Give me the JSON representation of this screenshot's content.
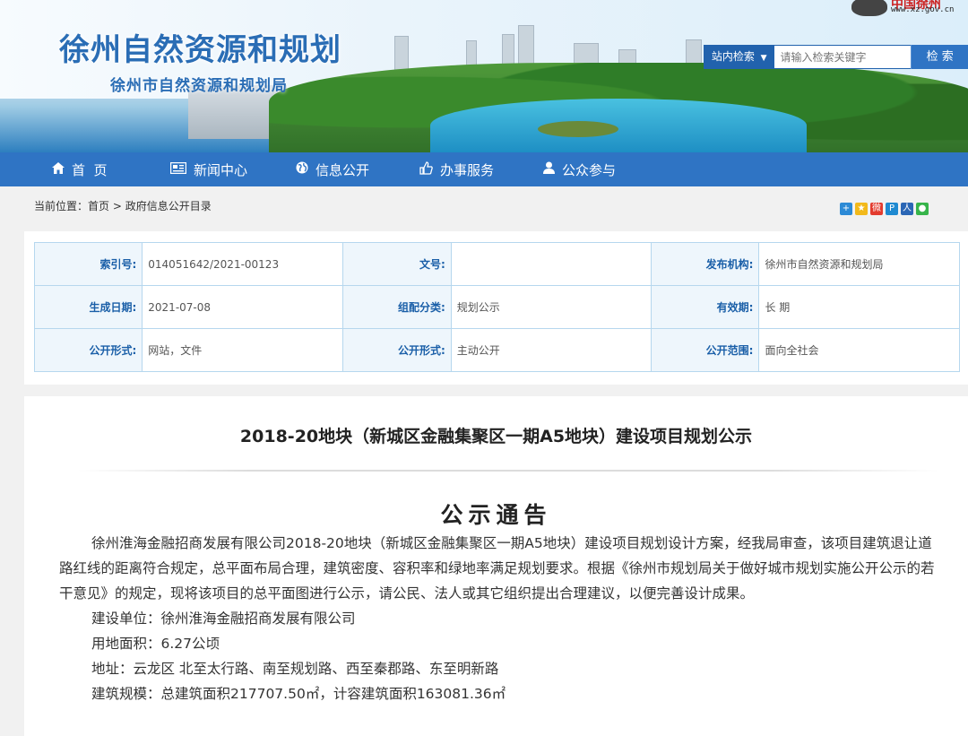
{
  "header": {
    "title": "徐州自然资源和规划",
    "subtitle": "徐州市自然资源和规划局",
    "logo_text": "中国徐州",
    "logo_url": "www.xz.gov.cn"
  },
  "search": {
    "scope_label": "站内检索",
    "placeholder": "请输入检索关键字",
    "button_label": "检 索"
  },
  "nav": {
    "items": [
      {
        "icon": "home-icon",
        "label": "首  页"
      },
      {
        "icon": "newspaper-icon",
        "label": "新闻中心"
      },
      {
        "icon": "globe-icon",
        "label": "信息公开"
      },
      {
        "icon": "thumbs-up-icon",
        "label": "办事服务"
      },
      {
        "icon": "user-icon",
        "label": "公众参与"
      }
    ]
  },
  "breadcrumb": {
    "prefix": "当前位置：",
    "home": "首页",
    "sep": " > ",
    "current": "政府信息公开目录"
  },
  "share_icons": [
    {
      "name": "share-plus-icon",
      "color": "#2c8ad6"
    },
    {
      "name": "share-qzone-icon",
      "color": "#f2b91b"
    },
    {
      "name": "share-weibo-icon",
      "color": "#e33b2e"
    },
    {
      "name": "share-tqq-icon",
      "color": "#1f8ad1"
    },
    {
      "name": "share-renren-icon",
      "color": "#2b66b5"
    },
    {
      "name": "share-wechat-icon",
      "color": "#37b44a"
    }
  ],
  "meta": {
    "rows": [
      [
        {
          "label": "索引号:",
          "value": "014051642/2021-00123"
        },
        {
          "label": "文号:",
          "value": ""
        },
        {
          "label": "发布机构:",
          "value": "徐州市自然资源和规划局"
        }
      ],
      [
        {
          "label": "生成日期:",
          "value": "2021-07-08"
        },
        {
          "label": "组配分类:",
          "value": "规划公示"
        },
        {
          "label": "有效期:",
          "value": "长 期"
        }
      ],
      [
        {
          "label": "公开形式:",
          "value": "网站，文件"
        },
        {
          "label": "公开形式:",
          "value": "主动公开"
        },
        {
          "label": "公开范围:",
          "value": "面向全社会"
        }
      ]
    ]
  },
  "article": {
    "title": "2018-20地块（新城区金融集聚区一期A5地块）建设项目规划公示",
    "heading": "公示通告",
    "paragraph": "徐州淮海金融招商发展有限公司2018-20地块（新城区金融集聚区一期A5地块）建设项目规划设计方案，经我局审查，该项目建筑退让道路红线的距离符合规定，总平面布局合理，建筑密度、容积率和绿地率满足规划要求。根据《徐州市规划局关于做好城市规划实施公开公示的若干意见》的规定，现将该项目的总平面图进行公示，请公民、法人或其它组织提出合理建议，以便完善设计成果。",
    "details": [
      "建设单位：徐州淮海金融招商发展有限公司",
      "用地面积：6.27公顷",
      "地址：云龙区 北至太行路、南至规划路、西至秦郡路、东至明新路",
      "建筑规模：总建筑面积217707.50㎡，计容建筑面积163081.36㎡"
    ]
  }
}
